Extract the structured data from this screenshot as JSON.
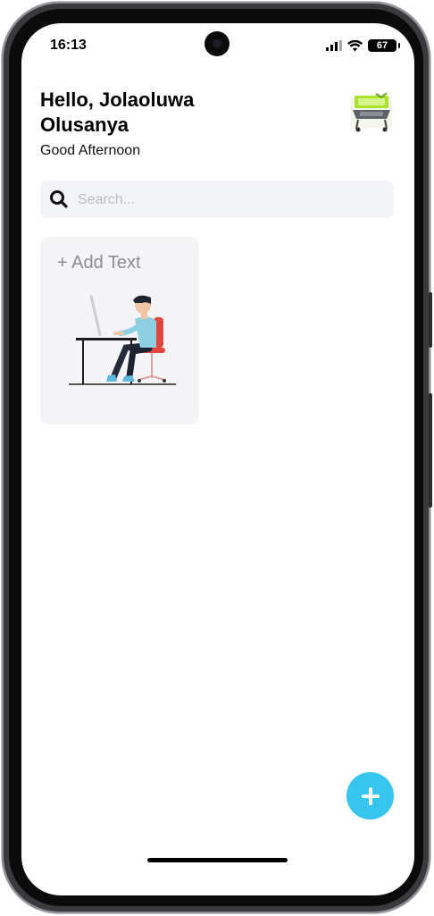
{
  "status_bar": {
    "time": "16:13",
    "battery_level": "67"
  },
  "header": {
    "greeting": "Hello, Jolaoluwa Olusanya",
    "subtitle": "Good Afternoon",
    "avatar_icon": "laptop-avatar-icon"
  },
  "search": {
    "placeholder": "Search...",
    "icon": "search-icon"
  },
  "notes": [
    {
      "title": "+ Add Text",
      "illustration": "person-at-desk-illustration"
    }
  ],
  "fab": {
    "icon": "plus-icon"
  },
  "colors": {
    "accent": "#35c5ef",
    "card_bg": "#f4f4f6",
    "search_bg": "#f2f4f8",
    "avatar_green": "#a8e22a",
    "shirt_blue": "#8ecfe4",
    "chair_red": "#e0463b"
  }
}
